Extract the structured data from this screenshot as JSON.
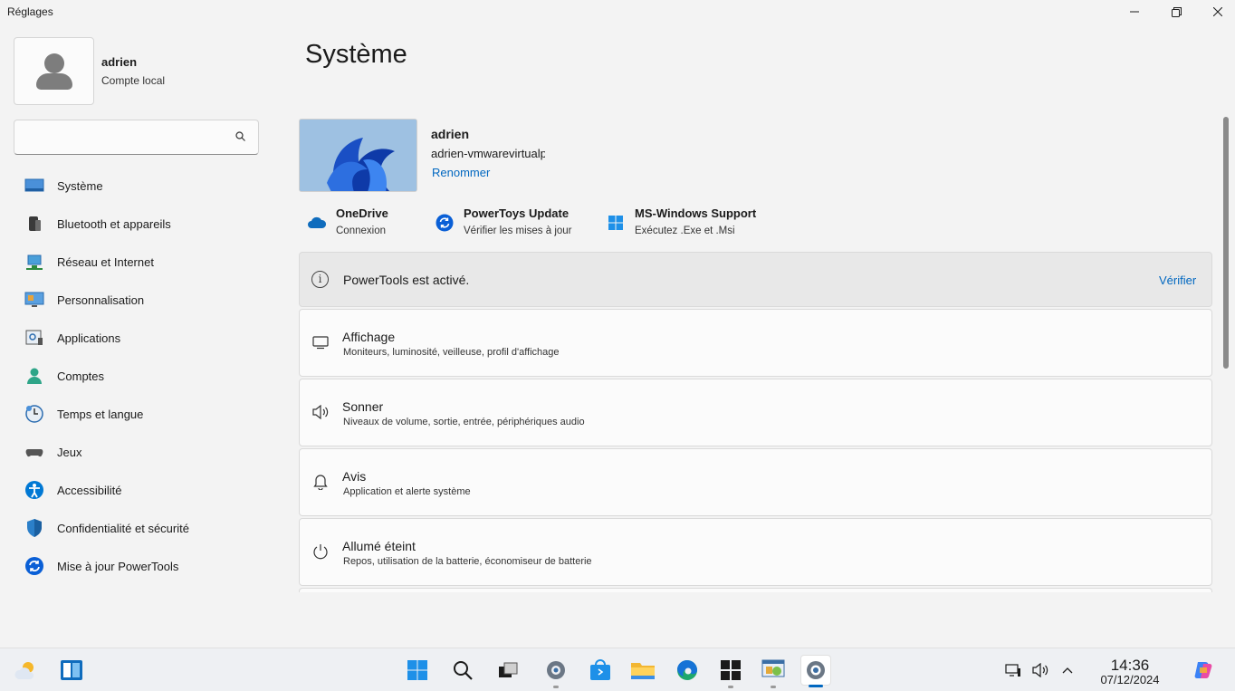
{
  "window": {
    "title": "Réglages"
  },
  "profile": {
    "name": "adrien",
    "account_type": "Compte local"
  },
  "search": {
    "value": "",
    "placeholder": ""
  },
  "sidebar": {
    "items": [
      {
        "label": "Système"
      },
      {
        "label": "Bluetooth et appareils"
      },
      {
        "label": "Réseau et Internet"
      },
      {
        "label": "Personnalisation"
      },
      {
        "label": "Applications"
      },
      {
        "label": "Comptes"
      },
      {
        "label": "Temps et langue"
      },
      {
        "label": "Jeux"
      },
      {
        "label": "Accessibilité"
      },
      {
        "label": "Confidentialité et sécurité"
      },
      {
        "label": "Mise à jour PowerTools"
      }
    ]
  },
  "main": {
    "title": "Système",
    "device": {
      "name": "adrien",
      "hostname": "adrien-vmwarevirtualp",
      "rename_label": "Renommer"
    },
    "quick_links": [
      {
        "title": "OneDrive",
        "subtitle": "Connexion"
      },
      {
        "title": "PowerToys Update",
        "subtitle": "Vérifier les mises à jour"
      },
      {
        "title": "MS-Windows Support",
        "subtitle": "Exécutez .Exe et .Msi"
      }
    ],
    "banner": {
      "text": "PowerTools est activé.",
      "action": "Vérifier"
    },
    "cards": [
      {
        "title": "Affichage",
        "subtitle": "Moniteurs, luminosité, veilleuse, profil d'affichage"
      },
      {
        "title": "Sonner",
        "subtitle": "Niveaux de volume, sortie, entrée, périphériques audio"
      },
      {
        "title": "Avis",
        "subtitle": "Application et alerte système"
      },
      {
        "title": "Allumé éteint",
        "subtitle": "Repos, utilisation de la batterie, économiseur de batterie"
      }
    ]
  },
  "taskbar": {
    "time": "14:36",
    "date": "07/12/2024",
    "apps": [
      "start",
      "search",
      "task-view",
      "settings",
      "store",
      "file-explorer",
      "edge",
      "terminal",
      "control-panel",
      "settings-active"
    ]
  },
  "colors": {
    "accent": "#0067c0",
    "background": "#f3f3f3",
    "card": "#fbfbfb"
  }
}
